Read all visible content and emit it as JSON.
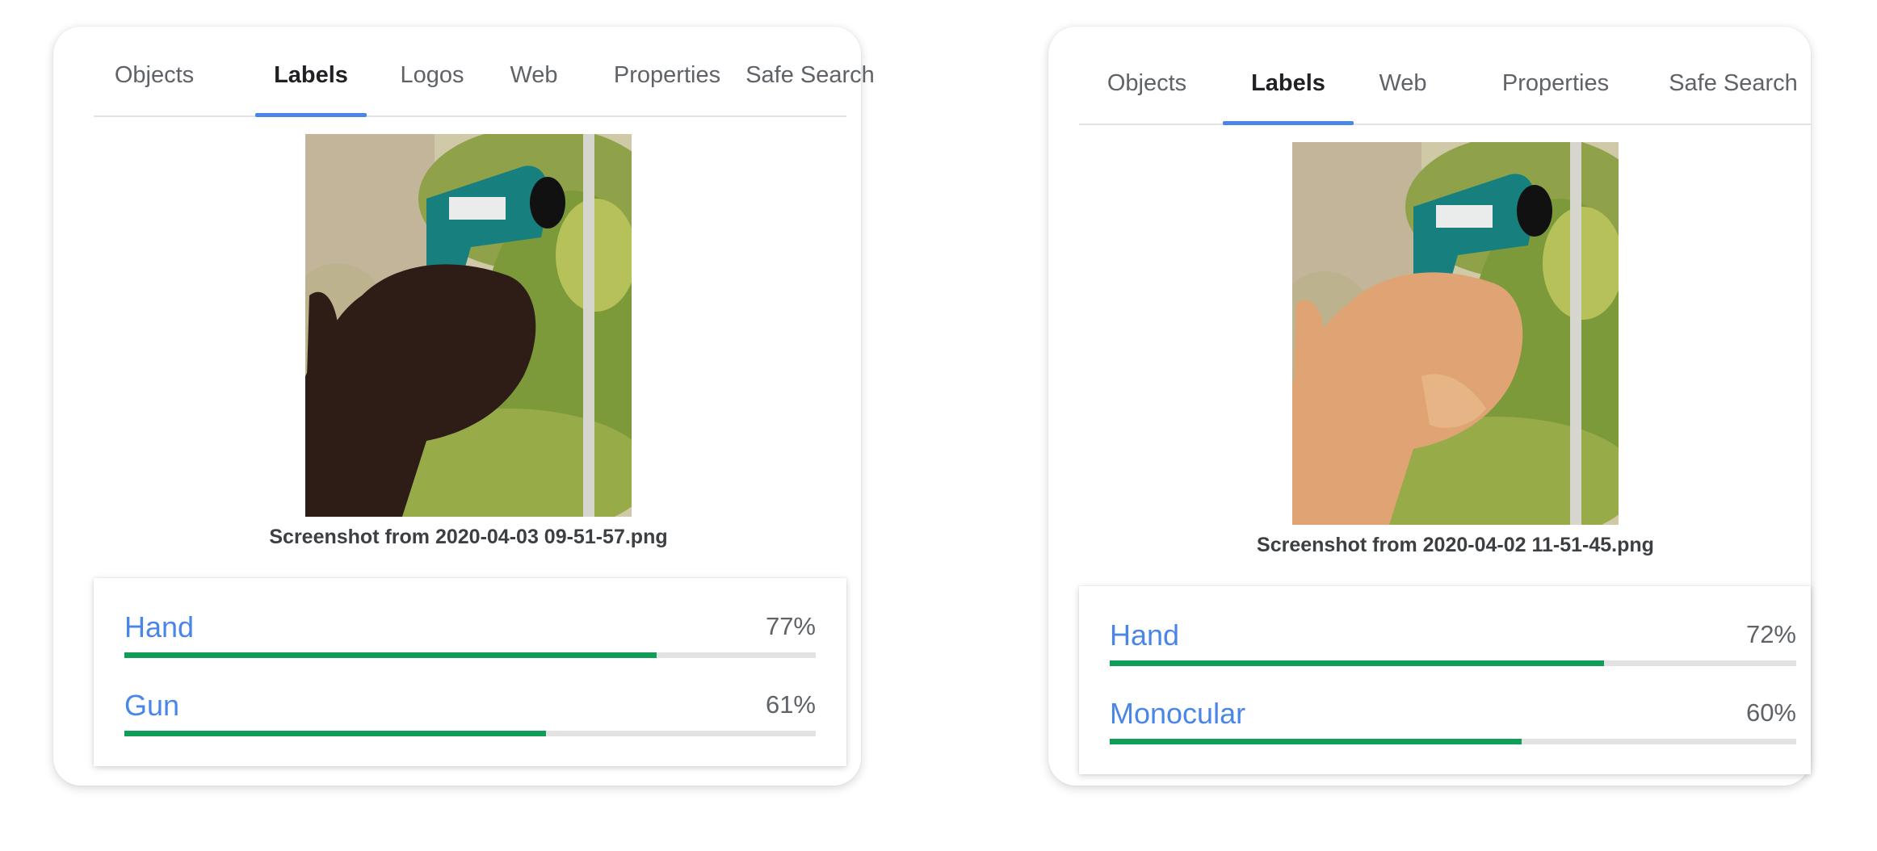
{
  "panels": [
    {
      "tabs": [
        "Objects",
        "Labels",
        "Logos",
        "Web",
        "Properties",
        "Safe Search"
      ],
      "active_tab": "Labels",
      "filename": "Screenshot from 2020-04-03 09-51-57.png",
      "labels": [
        {
          "name": "Hand",
          "score_text": "77%",
          "score": 0.77
        },
        {
          "name": "Gun",
          "score_text": "61%",
          "score": 0.61
        }
      ],
      "photo": {
        "skin_tone": "dark",
        "skin_color": "#2e1d17"
      }
    },
    {
      "tabs": [
        "Objects",
        "Labels",
        "Web",
        "Properties",
        "Safe Search"
      ],
      "active_tab": "Labels",
      "filename": "Screenshot from 2020-04-02 11-51-45.png",
      "labels": [
        {
          "name": "Hand",
          "score_text": "72%",
          "score": 0.72
        },
        {
          "name": "Monocular",
          "score_text": "60%",
          "score": 0.6
        }
      ],
      "photo": {
        "skin_tone": "light",
        "skin_color": "#e0a474"
      }
    }
  ],
  "colors": {
    "accent": "#4a86e8",
    "bar_fill": "#0f9d58",
    "bar_track": "#e2e2e2",
    "device": "#17807f"
  }
}
